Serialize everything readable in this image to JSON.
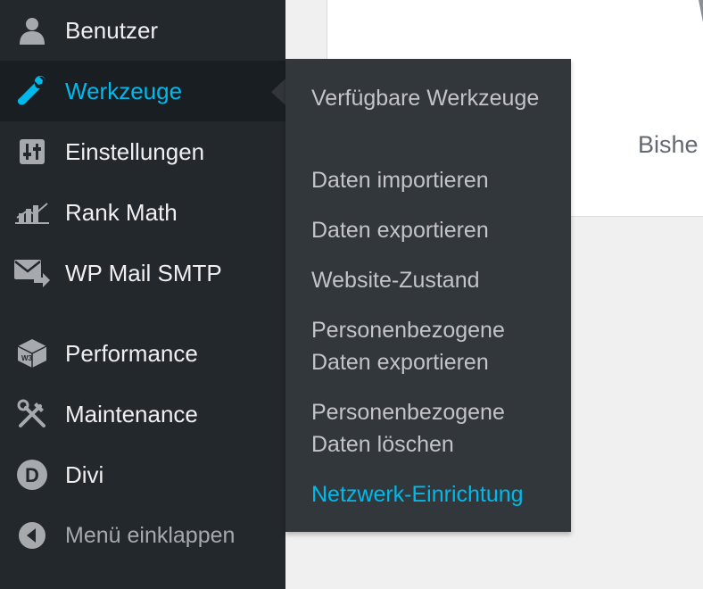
{
  "sidebar": {
    "items": [
      {
        "label": "Benutzer",
        "icon": "users-icon"
      },
      {
        "label": "Werkzeuge",
        "icon": "wrench-icon",
        "active": true
      },
      {
        "label": "Einstellungen",
        "icon": "settings-sliders-icon"
      },
      {
        "label": "Rank Math",
        "icon": "rank-math-icon"
      },
      {
        "label": "WP Mail SMTP",
        "icon": "mail-arrow-icon"
      },
      {
        "label": "Performance",
        "icon": "w3-cube-icon"
      },
      {
        "label": "Maintenance",
        "icon": "crossed-tools-icon"
      },
      {
        "label": "Divi",
        "icon": "divi-d-icon"
      }
    ],
    "collapse_label": "Menü einklappen"
  },
  "flyout": {
    "items": [
      {
        "label": "Verfügbare Werkzeuge"
      },
      {
        "label": "Daten importieren"
      },
      {
        "label": "Daten exportieren"
      },
      {
        "label": "Website-Zustand"
      },
      {
        "label": "Personenbezogene Daten exportieren"
      },
      {
        "label": "Personenbezogene Daten löschen"
      },
      {
        "label": "Netzwerk-Einrichtung",
        "current": true
      }
    ]
  },
  "content": {
    "partial_text": "Bishe"
  },
  "colors": {
    "sidebar_bg": "#23282d",
    "flyout_bg": "#32373c",
    "accent": "#00b9eb",
    "text": "#f0f0f1",
    "muted": "#a7aaad"
  }
}
